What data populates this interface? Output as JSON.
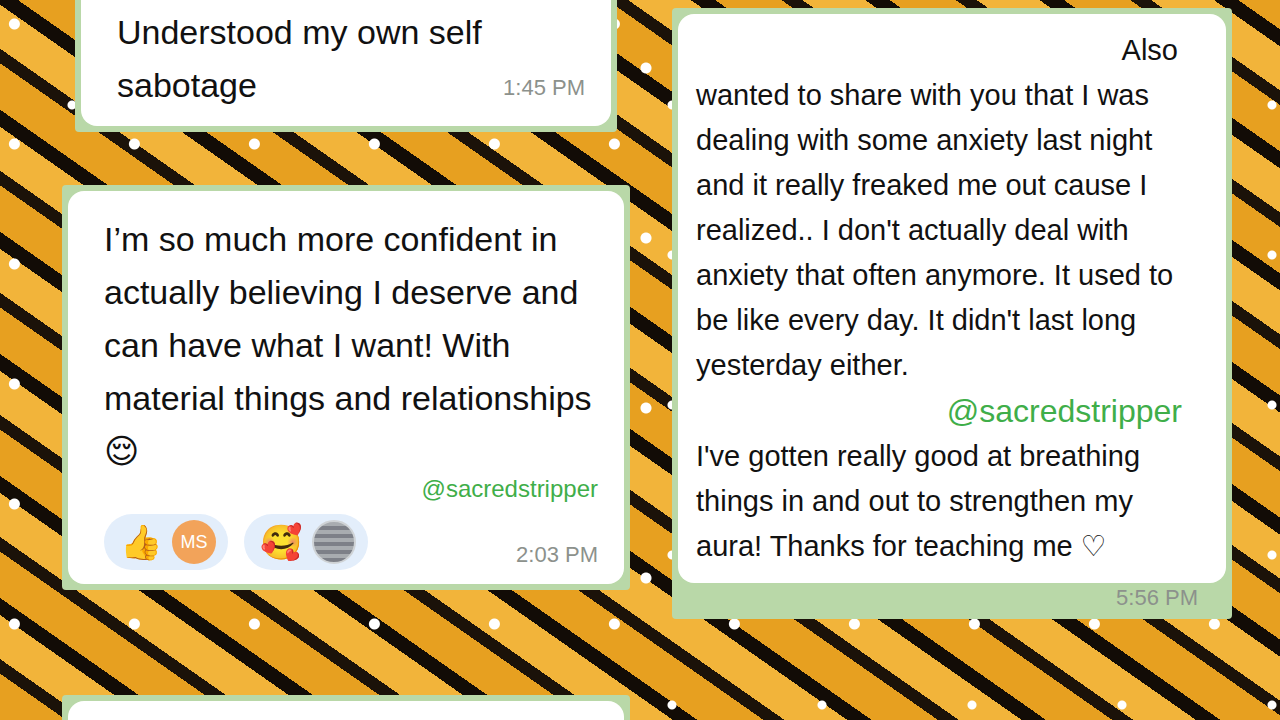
{
  "left_cards": [
    {
      "kind": "message",
      "text": "Understood my own self sabotage",
      "time": "1:45 PM"
    },
    {
      "kind": "message",
      "text": "I’m so much more confident in actually believing I deserve and can have what I want! With material things and relationships 😌",
      "watermark": "@sacredstripper",
      "reactions": [
        {
          "emoji": "👍",
          "kind": "initials",
          "avatar": "MS"
        },
        {
          "emoji": "🥰",
          "kind": "photo"
        }
      ],
      "time": "2:03 PM"
    },
    {
      "kind": "empty"
    }
  ],
  "right_card": {
    "lead": "Also",
    "paragraphs": [
      "wanted to share with you that I was dealing with some anxiety last night and it really freaked me out cause I realized.. I don't actually deal with anxiety that often anymore. It used to be like every day. It didn't last long yesterday either.",
      "I've gotten really good at breathing things in and out to strengthen my aura! Thanks for teaching me ♡"
    ],
    "watermark": "@sacredstripper",
    "time": "5:56 PM"
  }
}
